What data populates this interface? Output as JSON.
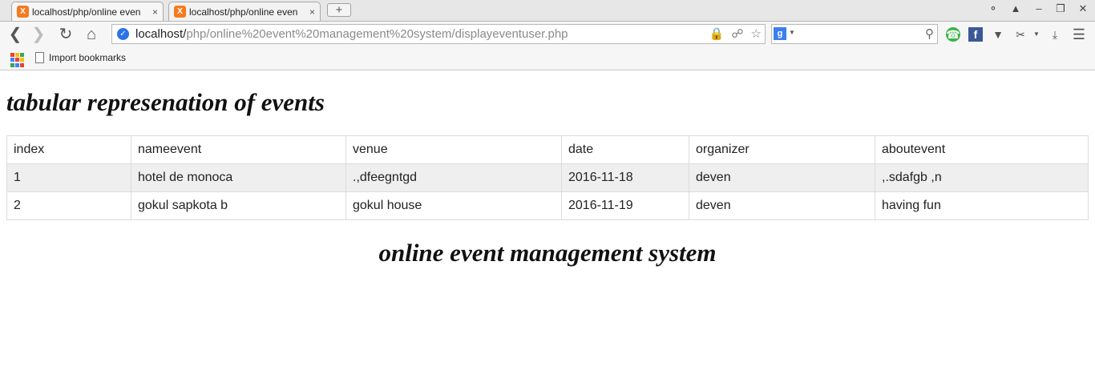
{
  "browser": {
    "tabs": [
      {
        "title": "localhost/php/online even",
        "close": "×",
        "favicon": "X"
      },
      {
        "title": "localhost/php/online even",
        "close": "×",
        "favicon": "X"
      }
    ],
    "new_tab": "+",
    "address": {
      "host": "localhost/",
      "path": "php/online%20event%20management%20system/displayeventuser.php"
    },
    "search_engine": "g",
    "bookmarks": {
      "import_label": "Import bookmarks"
    },
    "colors": {
      "favicon": "#f47b20",
      "accent": "#2a73e8"
    }
  },
  "page": {
    "heading": "tabular represenation of events",
    "table": {
      "headers": [
        "index",
        "nameevent",
        "venue",
        "date",
        "organizer",
        "aboutevent"
      ],
      "rows": [
        [
          "1",
          "hotel de monoca",
          ".,dfeegntgd",
          "2016-11-18",
          "deven",
          ",.sdafgb ,n"
        ],
        [
          "2",
          "gokul sapkota b",
          "gokul house",
          "2016-11-19",
          "deven",
          "having fun"
        ]
      ]
    },
    "footer_title": "online event management system"
  }
}
